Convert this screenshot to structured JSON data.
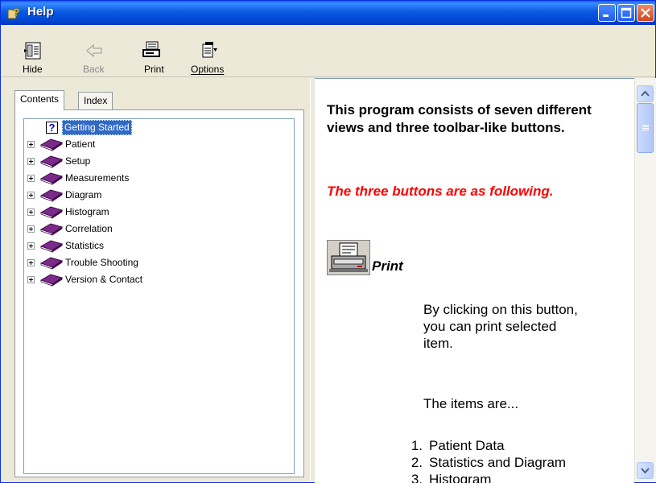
{
  "window": {
    "title": "Help"
  },
  "toolbar": {
    "hide_label": "Hide",
    "back_label": "Back",
    "print_label": "Print",
    "options_label": "Options"
  },
  "tabs": {
    "contents": "Contents",
    "index": "Index"
  },
  "tree": {
    "items": [
      {
        "label": "Getting Started",
        "icon": "question-page-icon",
        "selected": true
      },
      {
        "label": "Patient",
        "icon": "book-icon"
      },
      {
        "label": "Setup",
        "icon": "book-icon"
      },
      {
        "label": "Measurements",
        "icon": "book-icon"
      },
      {
        "label": "Diagram",
        "icon": "book-icon"
      },
      {
        "label": "Histogram",
        "icon": "book-icon"
      },
      {
        "label": "Correlation",
        "icon": "book-icon"
      },
      {
        "label": "Statistics",
        "icon": "book-icon"
      },
      {
        "label": "Trouble Shooting",
        "icon": "book-icon"
      },
      {
        "label": "Version & Contact",
        "icon": "book-icon"
      }
    ]
  },
  "content": {
    "heading": "This program consists of seven different views and three toolbar-like buttons.",
    "subheading": "The three buttons are as following.",
    "print_title": "Print",
    "print_description": "By clicking on this button, you can print selected item.",
    "items_intro": "The items are...",
    "list": [
      {
        "num": "1.",
        "text": "Patient Data"
      },
      {
        "num": "2.",
        "text": "Statistics and Diagram"
      },
      {
        "num": "3.",
        "text": "Histogram"
      }
    ]
  },
  "colors": {
    "titlebar": "#0a5ae0",
    "selection": "#316ac5",
    "subheading": "#ff0000",
    "book": "#6b1a78"
  }
}
